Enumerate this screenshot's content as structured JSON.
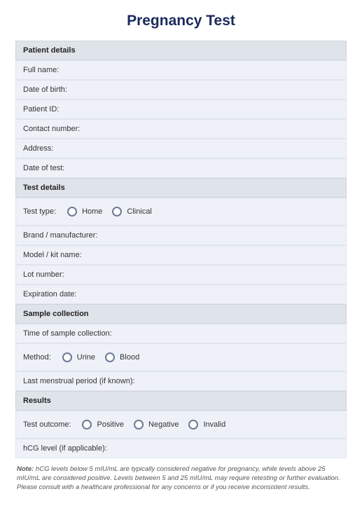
{
  "title": "Pregnancy Test",
  "sections": {
    "patient": {
      "header": "Patient details",
      "full_name": "Full name:",
      "dob": "Date of birth:",
      "patient_id": "Patient ID:",
      "contact": "Contact number:",
      "address": "Address:",
      "date_of_test": "Date of test:"
    },
    "test": {
      "header": "Test details",
      "test_type_label": "Test type:",
      "test_type_home": "Home",
      "test_type_clinical": "Clinical",
      "brand": "Brand / manufacturer:",
      "model": "Model / kit name:",
      "lot": "Lot number:",
      "expiration": "Expiration date:"
    },
    "sample": {
      "header": "Sample collection",
      "time": "Time of sample collection:",
      "method_label": "Method:",
      "method_urine": "Urine",
      "method_blood": "Blood",
      "lmp": "Last menstrual period (if known):"
    },
    "results": {
      "header": "Results",
      "outcome_label": "Test outcome:",
      "outcome_positive": "Positive",
      "outcome_negative": "Negative",
      "outcome_invalid": "Invalid",
      "hcg": "hCG level (if applicable):"
    }
  },
  "note": {
    "label": "Note:",
    "text": " hCG levels below 5 mIU/mL are typically considered negative for pregnancy, while levels above 25 mIU/mL are considered positive. Levels between 5 and 25 mIU/mL may require retesting or further evaluation. Please consult with a healthcare professional for any concerns or if you receive inconsistent results."
  }
}
